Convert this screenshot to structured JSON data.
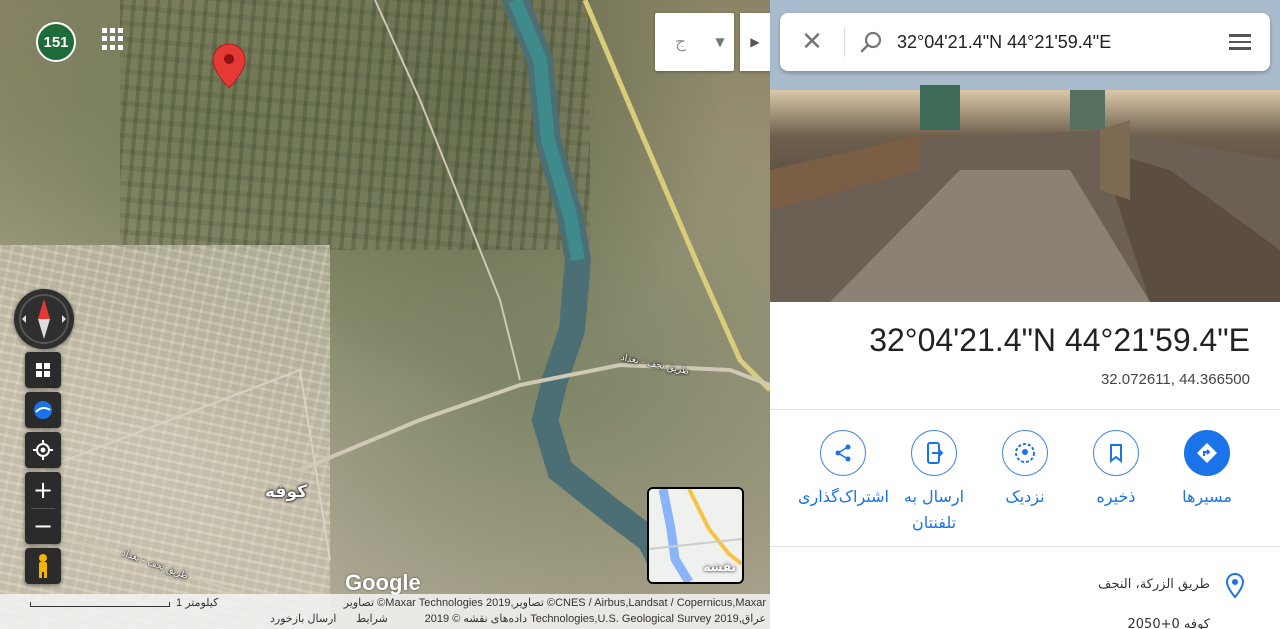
{
  "map": {
    "badge": "151",
    "language_box_text": "ج",
    "labels": {
      "city": "كوفه",
      "road_top": "طريق نجف - بغداد",
      "road_bottom": "طريق نجف - بغداد"
    },
    "google_logo": "Google",
    "minimap_label": "نقشه",
    "attribution": {
      "scale": "1 کیلومتر",
      "imagery": "تصاویر ©Maxar Technologies 2019,تصاویر ©CNES / Airbus,Landsat / Copernicus,Maxar",
      "map_data": "داده‌های نقشه © 2019 Technologies,U.S. Geological Survey 2019,عراق",
      "terms": "شرایط",
      "feedback": "ارسال بازخورد"
    }
  },
  "panel": {
    "search_query": "32°04'21.4\"N 44°21'59.4\"E",
    "title": "32°04'21.4\"N 44°21'59.4\"E",
    "decimal_coords": "32.072611, 44.366500",
    "actions": [
      {
        "icon": "directions-icon",
        "label": "مسیرها",
        "primary": true
      },
      {
        "icon": "bookmark-icon",
        "label": "ذخیره",
        "primary": false
      },
      {
        "icon": "nearby-icon",
        "label": "نزدیک",
        "primary": false
      },
      {
        "icon": "send-to-phone-icon",
        "label": "ارسال به تلفنتان",
        "primary": false
      },
      {
        "icon": "share-icon",
        "label": "اشتراک‌گذاری",
        "primary": false
      }
    ],
    "address": "طريق الزركة، النجف",
    "next_line": "2050+0 كوفه"
  },
  "colors": {
    "accent": "#1a73e8",
    "pin": "#e53935",
    "control_bg": "#2b2b2b"
  }
}
